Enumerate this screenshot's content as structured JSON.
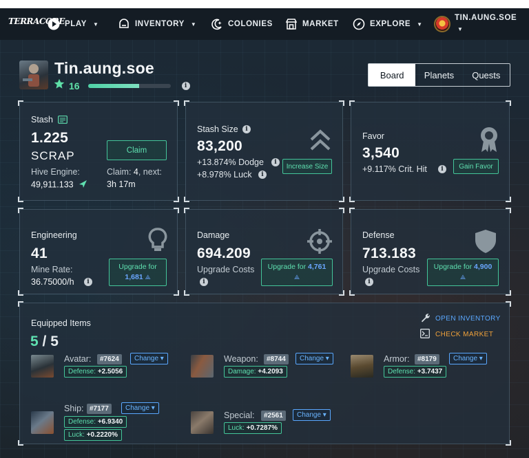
{
  "nav": {
    "logo": "TERRACORE",
    "items": [
      {
        "label": "PLAY",
        "caret": true
      },
      {
        "label": "INVENTORY",
        "caret": true
      },
      {
        "label": "COLONIES",
        "caret": false
      },
      {
        "label": "MARKET",
        "caret": false
      },
      {
        "label": "EXPLORE",
        "caret": true
      }
    ],
    "username": "TIN.AUNG.SOE"
  },
  "profile": {
    "name": "Tin.aung.soe",
    "level": "16",
    "xp_fraction": 0.62
  },
  "tabs": [
    "Board",
    "Planets",
    "Quests"
  ],
  "stash": {
    "title": "Stash",
    "amount": "1.225",
    "unit": "SCRAP",
    "claim_label": "Claim",
    "hive_label": "Hive Engine:",
    "hive_value": "49,911.133",
    "claim_info_prefix": "Claim: ",
    "claim_count": "4",
    "claim_info_suffix": ", next:",
    "next_time": "3h 17m"
  },
  "stash_size": {
    "title": "Stash Size",
    "value": "83,200",
    "dodge": "+13.874% Dodge",
    "luck": "+8.978% Luck",
    "button": "Increase Size"
  },
  "favor": {
    "title": "Favor",
    "value": "3,540",
    "crit": "+9.117% Crit. Hit",
    "button": "Gain Favor"
  },
  "engineering": {
    "title": "Engineering",
    "value": "41",
    "rate_label": "Mine Rate:",
    "rate_value": "36.75000/h",
    "button_line1": "Upgrade for",
    "button_cost": "1,681"
  },
  "damage": {
    "title": "Damage",
    "value": "694.209",
    "costs_label": "Upgrade Costs",
    "button_line1": "Upgrade for ",
    "button_cost": "4,761"
  },
  "defense": {
    "title": "Defense",
    "value": "713.183",
    "costs_label": "Upgrade Costs",
    "button_line1": "Upgrade for ",
    "button_cost": "4,900"
  },
  "equipped": {
    "title": "Equipped Items",
    "count_have": "5",
    "count_sep": " / ",
    "count_total": "5",
    "open_inventory": "OPEN INVENTORY",
    "check_market": "CHECK MARKET",
    "change_label": "Change",
    "slots": {
      "avatar": {
        "label": "Avatar:",
        "id": "#7624",
        "stats": [
          {
            "k": "Defense:",
            "v": "+2.5056"
          }
        ]
      },
      "weapon": {
        "label": "Weapon:",
        "id": "#8744",
        "stats": [
          {
            "k": "Damage:",
            "v": "+4.2093"
          }
        ]
      },
      "armor": {
        "label": "Armor:",
        "id": "#8179",
        "stats": [
          {
            "k": "Defense:",
            "v": "+3.7437"
          }
        ]
      },
      "ship": {
        "label": "Ship:",
        "id": "#7177",
        "stats": [
          {
            "k": "Defense:",
            "v": "+6.9340"
          },
          {
            "k": "Luck:",
            "v": "+0.2220%"
          }
        ]
      },
      "special": {
        "label": "Special:",
        "id": "#2561",
        "stats": [
          {
            "k": "Luck:",
            "v": "+0.7287%"
          }
        ]
      }
    }
  },
  "colors": {
    "accent_green": "#5fe0b0",
    "accent_blue": "#5aa8ff",
    "accent_orange": "#f0a23a",
    "nav_bg": "#141c24"
  }
}
